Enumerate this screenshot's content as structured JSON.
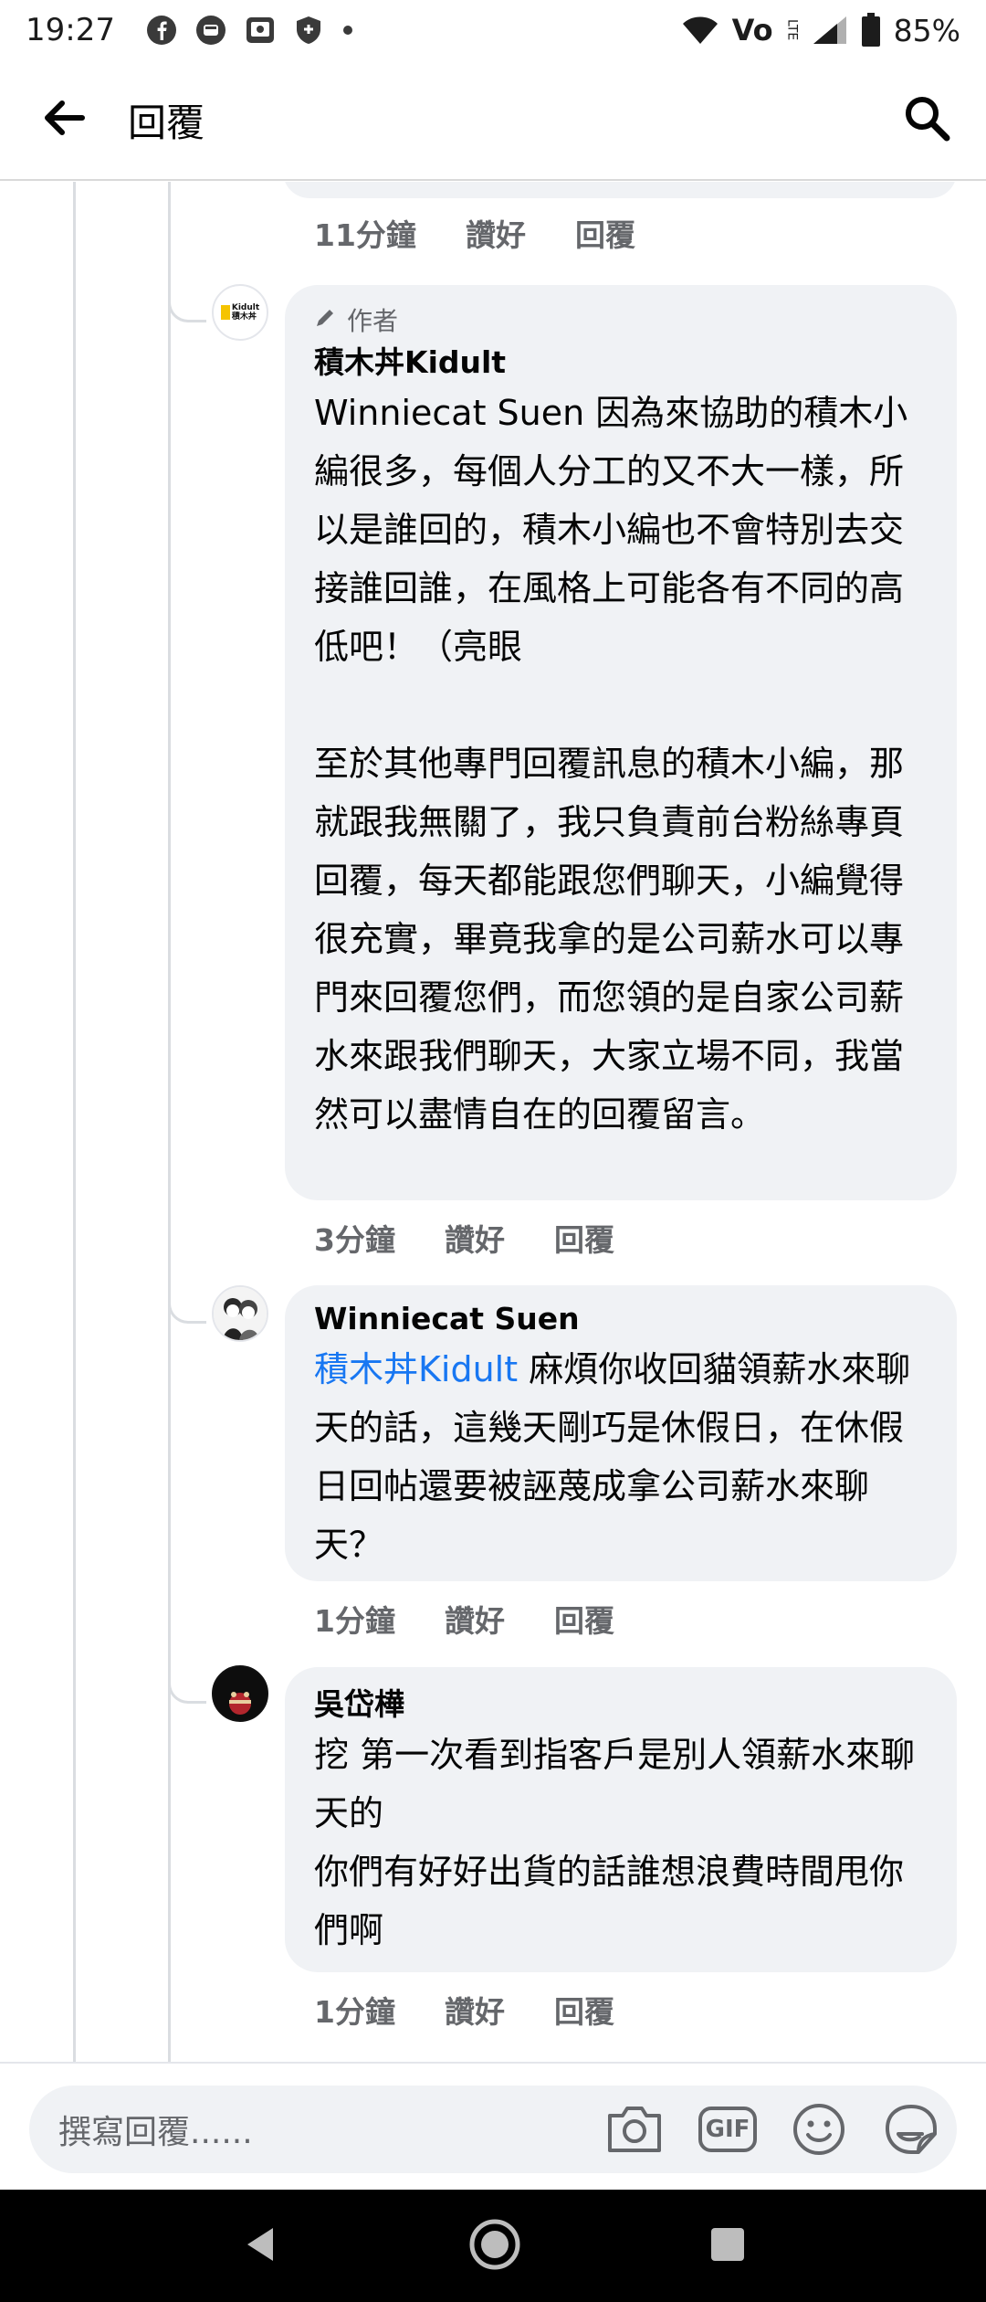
{
  "status_bar": {
    "time": "19:27",
    "network_label": "Vo",
    "lte_label": "LTE",
    "battery": "85%"
  },
  "app_bar": {
    "title": "回覆"
  },
  "previous_comment": {
    "time": "11分鐘",
    "like": "讚好",
    "reply": "回覆"
  },
  "comments": [
    {
      "badge": "作者",
      "author": "積木丼Kidult",
      "avatar_text_top": "Kidult",
      "avatar_text_bottom": "積木丼",
      "body": "Winniecat Suen 因為來協助的積木小編很多，每個人分工的又不大一樣，所以是誰回的，積木小編也不會特別去交接誰回誰，在風格上可能各有不同的高低吧！（亮眼\n\n至於其他專門回覆訊息的積木小編，那就跟我無關了，我只負責前台粉絲專頁回覆，每天都能跟您們聊天，小編覺得很充實，畢竟我拿的是公司薪水可以專門來回覆您們，而您領的是自家公司薪水來跟我們聊天，大家立場不同，我當然可以盡情自在的回覆留言。",
      "time": "3分鐘",
      "like": "讚好",
      "reply": "回覆"
    },
    {
      "author": "Winniecat Suen",
      "mention": "積木丼Kidult",
      "body": " 麻煩你收回貓領薪水來聊天的話，這幾天剛巧是休假日，在休假日回帖還要被誣蔑成拿公司薪水來聊天？",
      "time": "1分鐘",
      "like": "讚好",
      "reply": "回覆"
    },
    {
      "author": "吳岱樺",
      "body": "挖 第一次看到指客戶是別人領薪水來聊天的\n你們有好好出貨的話誰想浪費時間甩你們啊",
      "time": "1分鐘",
      "like": "讚好",
      "reply": "回覆"
    }
  ],
  "composer": {
    "placeholder": "撰寫回覆......",
    "gif_label": "GIF"
  }
}
